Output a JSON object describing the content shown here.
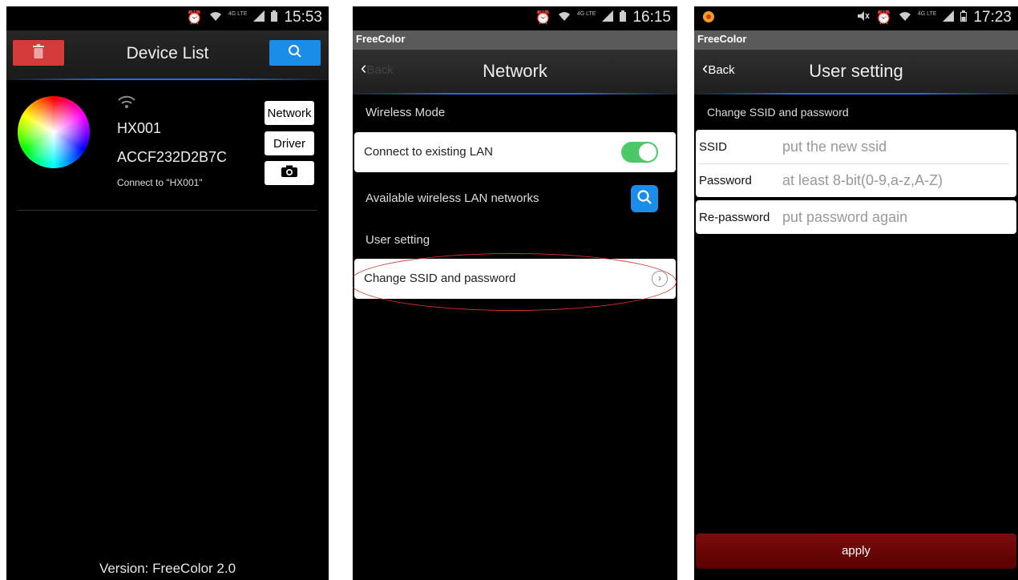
{
  "screen1": {
    "status": {
      "time": "15:53",
      "network": "4G LTE"
    },
    "header": {
      "title": "Device List",
      "delete_icon": "trash-icon",
      "search_icon": "search-icon"
    },
    "device": {
      "name": "HX001",
      "mac": "ACCF232D2B7C",
      "connection": "Connect to \"HX001\"",
      "buttons": {
        "network": "Network",
        "driver": "Driver",
        "camera_icon": "camera-icon"
      }
    },
    "footer": {
      "version": "Version: FreeColor 2.0"
    }
  },
  "screen2": {
    "status": {
      "time": "16:15",
      "network": "4G LTE"
    },
    "app_name": "FreeColor",
    "nav": {
      "back": "Back",
      "title": "Network"
    },
    "sections": {
      "wireless_mode": "Wireless Mode",
      "connect_existing": "Connect to existing LAN",
      "connect_toggle_on": true,
      "available_networks": "Available wireless LAN networks",
      "user_setting": "User setting",
      "change_ssid": "Change SSID and password"
    },
    "colors": {
      "toggle": "#4cc966",
      "accent": "#1b8ce8",
      "highlight": "#d32f2f"
    }
  },
  "screen3": {
    "status": {
      "time": "17:23",
      "network": "4G LTE"
    },
    "app_name": "FreeColor",
    "nav": {
      "back": "Back",
      "title": "User setting"
    },
    "subtitle": "Change SSID and password",
    "fields": {
      "ssid": {
        "label": "SSID",
        "placeholder": "put the new ssid"
      },
      "password": {
        "label": "Password",
        "placeholder": "at least 8-bit(0-9,a-z,A-Z)"
      },
      "repassword": {
        "label": "Re-password",
        "placeholder": "put password again"
      }
    },
    "apply": "apply",
    "colors": {
      "apply": "#6b0606"
    }
  }
}
